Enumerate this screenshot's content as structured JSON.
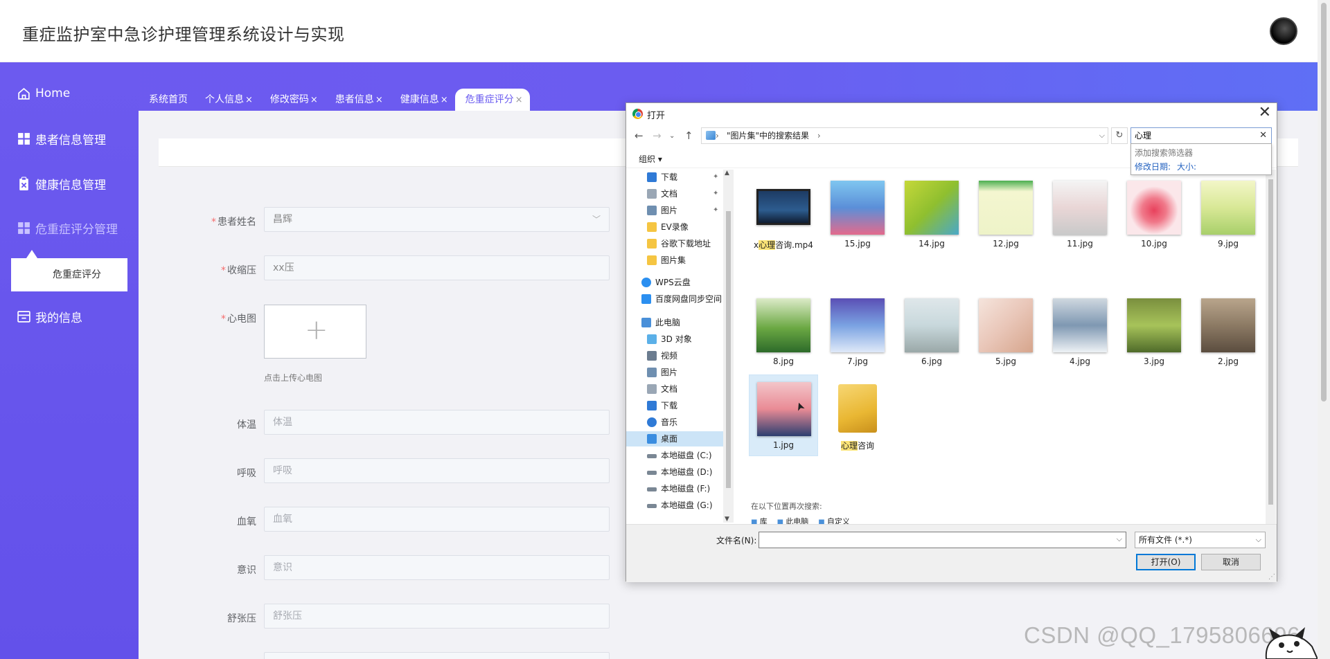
{
  "header": {
    "title": "重症监护室中急诊护理管理系统设计与实现"
  },
  "sidebar": {
    "items": [
      {
        "label": "Home",
        "icon": "home-icon"
      },
      {
        "label": "患者信息管理",
        "icon": "grid-icon"
      },
      {
        "label": "健康信息管理",
        "icon": "clipboard-icon"
      },
      {
        "label": "危重症评分管理",
        "icon": "grid-icon"
      },
      {
        "label": "我的信息",
        "icon": "profile-card-icon"
      }
    ],
    "submenu": {
      "label": "危重症评分"
    }
  },
  "tabs": [
    {
      "label": "系统首页",
      "closable": false
    },
    {
      "label": "个人信息",
      "closable": true
    },
    {
      "label": "修改密码",
      "closable": true
    },
    {
      "label": "患者信息",
      "closable": true
    },
    {
      "label": "健康信息",
      "closable": true
    },
    {
      "label": "危重症评分",
      "closable": true,
      "active": true
    }
  ],
  "tab_close_glyph": "×",
  "form": {
    "fields": [
      {
        "label": "患者姓名",
        "required": true,
        "value": "昌辉",
        "type": "select"
      },
      {
        "label": "收缩压",
        "required": true,
        "value": "xx压",
        "type": "input"
      },
      {
        "label": "心电图",
        "required": true,
        "type": "upload",
        "hint": "点击上传心电图"
      },
      {
        "label": "体温",
        "placeholder": "体温",
        "type": "input"
      },
      {
        "label": "呼吸",
        "placeholder": "呼吸",
        "type": "input"
      },
      {
        "label": "血氧",
        "placeholder": "血氧",
        "type": "input"
      },
      {
        "label": "意识",
        "placeholder": "意识",
        "type": "input"
      },
      {
        "label": "舒张压",
        "placeholder": "舒张压",
        "type": "input"
      }
    ]
  },
  "dialog": {
    "title": "打开",
    "address": "\"图片集\"中的搜索结果",
    "search_value": "心理",
    "suggest": {
      "line1": "添加搜索筛选器",
      "date": "修改日期:",
      "size": "大小:"
    },
    "organize": "组织 ▾",
    "nav": [
      {
        "label": "下载",
        "icon": "download-icon",
        "pinned": true
      },
      {
        "label": "文档",
        "icon": "document-icon",
        "pinned": true
      },
      {
        "label": "图片",
        "icon": "picture-icon",
        "pinned": true
      },
      {
        "label": "EV录像",
        "icon": "folder-icon"
      },
      {
        "label": "谷歌下载地址",
        "icon": "folder-icon"
      },
      {
        "label": "图片集",
        "icon": "folder-icon"
      },
      {
        "label": "WPS云盘",
        "icon": "cloud-icon"
      },
      {
        "label": "百度网盘同步空间",
        "icon": "baidu-icon"
      },
      {
        "label": "此电脑",
        "icon": "computer-icon"
      },
      {
        "label": "3D 对象",
        "icon": "cube-icon"
      },
      {
        "label": "视频",
        "icon": "video-icon"
      },
      {
        "label": "图片",
        "icon": "picture-icon"
      },
      {
        "label": "文档",
        "icon": "document-icon"
      },
      {
        "label": "下载",
        "icon": "download-icon"
      },
      {
        "label": "音乐",
        "icon": "music-icon"
      },
      {
        "label": "桌面",
        "icon": "desktop-icon",
        "selected": true
      },
      {
        "label": "本地磁盘 (C:)",
        "icon": "drive-icon"
      },
      {
        "label": "本地磁盘 (D:)",
        "icon": "drive-icon"
      },
      {
        "label": "本地磁盘 (F:)",
        "icon": "drive-icon"
      },
      {
        "label": "本地磁盘 (G:)",
        "icon": "drive-icon"
      }
    ],
    "files": [
      {
        "name_pre": "x",
        "name_hl": "心理",
        "name_post": "咨询.mp4",
        "kind": "video"
      },
      {
        "name": "15.jpg",
        "kind": "image"
      },
      {
        "name": "14.jpg",
        "kind": "image"
      },
      {
        "name": "12.jpg",
        "kind": "image"
      },
      {
        "name": "11.jpg",
        "kind": "image"
      },
      {
        "name": "10.jpg",
        "kind": "image"
      },
      {
        "name": "9.jpg",
        "kind": "image"
      },
      {
        "name": "8.jpg",
        "kind": "image"
      },
      {
        "name": "7.jpg",
        "kind": "image"
      },
      {
        "name": "6.jpg",
        "kind": "image"
      },
      {
        "name": "5.jpg",
        "kind": "image"
      },
      {
        "name": "4.jpg",
        "kind": "image"
      },
      {
        "name": "3.jpg",
        "kind": "image"
      },
      {
        "name": "2.jpg",
        "kind": "image"
      },
      {
        "name": "1.jpg",
        "kind": "image",
        "selected": true
      },
      {
        "name_pre": "",
        "name_hl": "心理",
        "name_post": "咨询",
        "kind": "folder"
      }
    ],
    "search_again": "在以下位置再次搜索:",
    "search_locations": [
      "库",
      "此电脑",
      "自定义"
    ],
    "filename_label": "文件名(N):",
    "filename_value": "",
    "filetype": "所有文件 (*.*)",
    "open_button": "打开(O)",
    "cancel_button": "取消"
  },
  "watermark": "CSDN @QQ_1795806696"
}
